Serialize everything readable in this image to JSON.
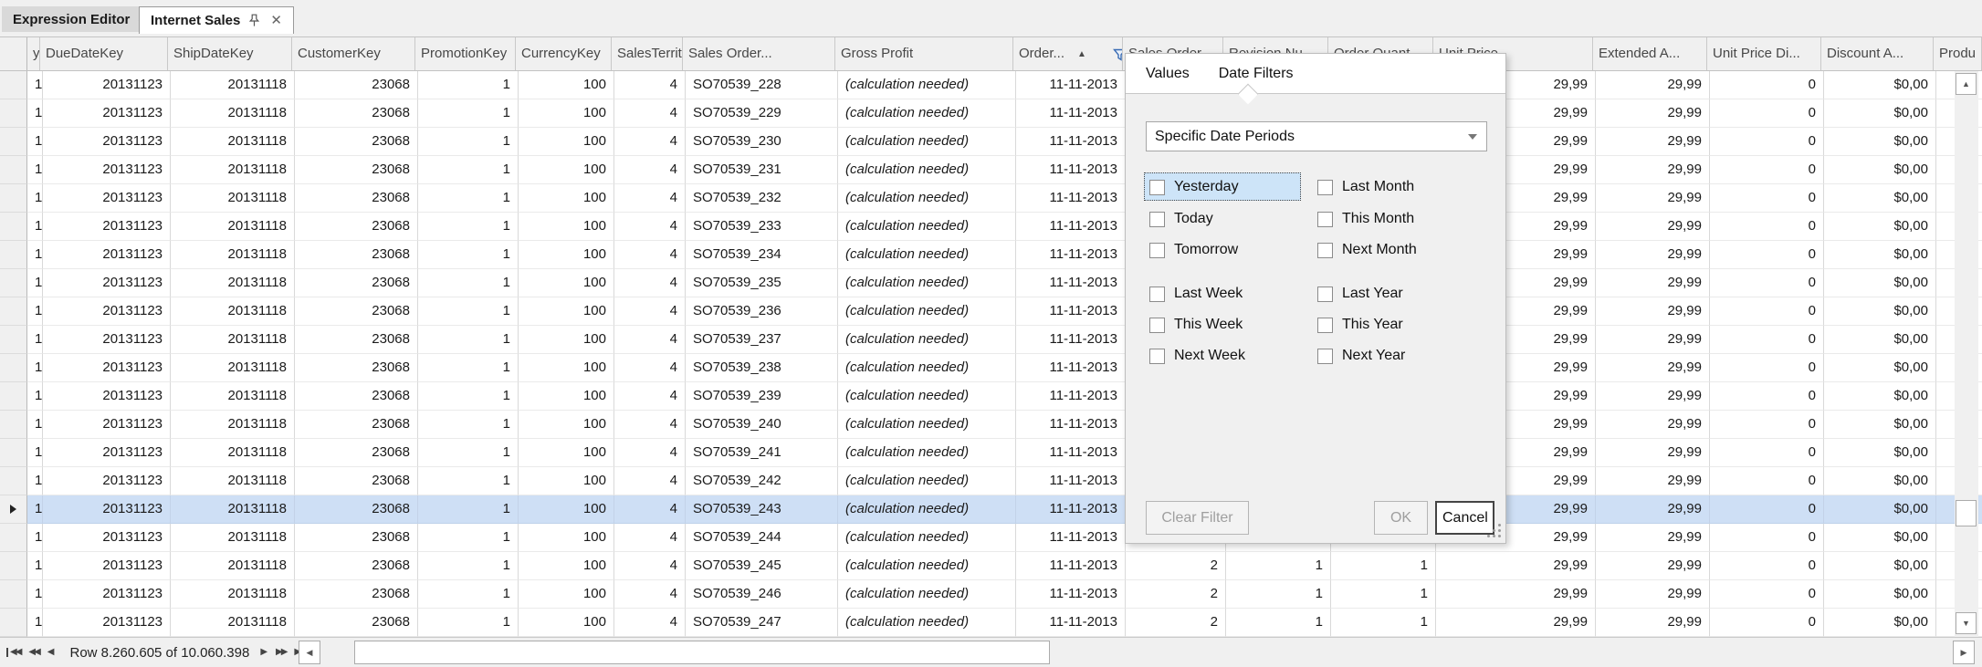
{
  "tabs": [
    {
      "label": "Expression Editor",
      "active": false
    },
    {
      "label": "Internet Sales",
      "active": true
    }
  ],
  "grid": {
    "columns": [
      {
        "key": "rowheader",
        "label": "",
        "align": "left"
      },
      {
        "key": "y",
        "label": "y",
        "align": "right"
      },
      {
        "key": "DueDateKey",
        "label": "DueDateKey",
        "align": "right"
      },
      {
        "key": "ShipDateKey",
        "label": "ShipDateKey",
        "align": "right"
      },
      {
        "key": "CustomerKey",
        "label": "CustomerKey",
        "align": "right"
      },
      {
        "key": "PromotionKey",
        "label": "PromotionKey",
        "align": "right"
      },
      {
        "key": "CurrencyKey",
        "label": "CurrencyKey",
        "align": "right"
      },
      {
        "key": "SalesTerritory",
        "label": "SalesTerritor...",
        "align": "right"
      },
      {
        "key": "SalesOrderNumber",
        "label": "Sales Order...",
        "align": "left"
      },
      {
        "key": "GrossProfit",
        "label": "Gross Profit",
        "align": "left",
        "italic": true
      },
      {
        "key": "OrderDate",
        "label": "Order...",
        "align": "right",
        "sorted": "ascending",
        "filtered": true
      },
      {
        "key": "SalesOrderLine",
        "label": "Sales Order...",
        "align": "right"
      },
      {
        "key": "RevisionNumber",
        "label": "Revision Nu...",
        "align": "right"
      },
      {
        "key": "OrderQuantity",
        "label": "Order Quant...",
        "align": "right"
      },
      {
        "key": "UnitPrice",
        "label": "Unit Price",
        "align": "right"
      },
      {
        "key": "ExtendedAmount",
        "label": "Extended A...",
        "align": "right"
      },
      {
        "key": "UnitPriceDiscount",
        "label": "Unit Price Di...",
        "align": "right"
      },
      {
        "key": "DiscountAmount",
        "label": "Discount A...",
        "align": "right"
      },
      {
        "key": "Product",
        "label": "Produ",
        "align": "left"
      }
    ],
    "base_row": {
      "y": "1",
      "DueDateKey": "20131123",
      "ShipDateKey": "20131118",
      "CustomerKey": "23068",
      "PromotionKey": "1",
      "CurrencyKey": "100",
      "SalesTerritory": "4",
      "GrossProfit": "(calculation needed)",
      "OrderDate": "11-11-2013",
      "SalesOrderLine": "2",
      "RevisionNumber": "1",
      "OrderQuantity": "1",
      "UnitPrice": "29,99",
      "ExtendedAmount": "29,99",
      "UnitPriceDiscount": "0",
      "DiscountAmount": "$0,00",
      "Product": ""
    },
    "sales_order_numbers": [
      "SO70539_228",
      "SO70539_229",
      "SO70539_230",
      "SO70539_231",
      "SO70539_232",
      "SO70539_233",
      "SO70539_234",
      "SO70539_235",
      "SO70539_236",
      "SO70539_237",
      "SO70539_238",
      "SO70539_239",
      "SO70539_240",
      "SO70539_241",
      "SO70539_242",
      "SO70539_243",
      "SO70539_244",
      "SO70539_245",
      "SO70539_246",
      "SO70539_247"
    ],
    "selected_row_index": 15
  },
  "filter_popup": {
    "tabs": [
      "Values",
      "Date Filters"
    ],
    "active_tab": "Date Filters",
    "dropdown_value": "Specific Date Periods",
    "groups": [
      {
        "left": [
          "Yesterday",
          "Today",
          "Tomorrow"
        ],
        "right": [
          "Last Month",
          "This Month",
          "Next Month"
        ]
      },
      {
        "left": [
          "Last Week",
          "This Week",
          "Next Week"
        ],
        "right": [
          "Last Year",
          "This Year",
          "Next Year"
        ]
      }
    ],
    "focused_item": "Yesterday",
    "checked_items": [],
    "buttons": {
      "clear": "Clear Filter",
      "ok": "OK",
      "cancel": "Cancel"
    },
    "disabled_buttons": [
      "Clear Filter",
      "OK"
    ]
  },
  "status_bar": {
    "row_text": "Row 8.260.605 of 10.060.398"
  },
  "colors": {
    "selected_row": "#cedff5",
    "focused_filter_item": "#cde4f8",
    "filter_funnel_accent": "#3a6cb4",
    "panel_gray": "#f0f0f0"
  }
}
